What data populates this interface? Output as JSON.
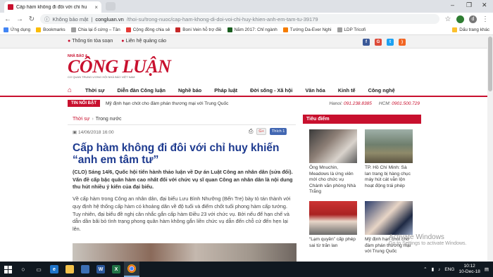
{
  "browser": {
    "tab_title": "Cấp hàm không đi đôi với chỉ hu",
    "security": "Không bảo mật",
    "url_host": "congluan.vn",
    "url_path": "/thoi-su/trong-nuoc/cap-ham-khong-di-doi-voi-chi-huy-khien-anh-em-tam-tu-39179",
    "avatar_letter": "d",
    "bookmarks": [
      "Ứng dụng",
      "Bookmarks",
      "Chia lại ổ cứng – Tân",
      "Cộng đồng chia sẻ",
      "Boni Vein hỗ trợ điề",
      "Năm 2017: Chỉ ngành",
      "Tướng Da-Ever Nghi",
      "LDP Tricofi"
    ],
    "bookmarks_right": "Dấu trang khác"
  },
  "topstrip": {
    "link1": "Thông tin tòa soạn",
    "link2": "Liên hệ quảng cáo"
  },
  "logo": {
    "small": "NHÀ BÁO &",
    "big": "CÔNG LUẬN",
    "tag": "CƠ QUAN TRUNG ƯƠNG HỘI NHÀ BÁO VIỆT NAM"
  },
  "nav": {
    "items": [
      "Thời sự",
      "Diễn đàn Công luận",
      "Nghề báo",
      "Pháp luật",
      "Đời sống - Xã hội",
      "Văn hóa",
      "Kinh tế",
      "Công nghệ"
    ]
  },
  "hotbar": {
    "badge": "TIN NỔI BẬT",
    "news": "Mỹ định hạn chót cho đàm phán thương mại với Trung Quốc",
    "hanoi_label": "Hanoi:",
    "hanoi_phone": "091.238.8385",
    "hcm_label": "HCM:",
    "hcm_phone": "0901.500.729"
  },
  "article": {
    "cat1": "Thời sự",
    "cat2": "Trong nước",
    "date": "14/06/2018 16:00",
    "gplus": "G+",
    "like": "Thích 1",
    "title": "Cấp hàm không đi đôi với chỉ huy khiến “anh em tâm tư”",
    "lead": "(CLO) Sáng 14/6, Quốc hội tiến hành thảo luận về Dự án Luật Công an nhân dân (sửa đổi). Vấn đề cấp bậc quân hàm cao nhất đối với chức vụ sĩ quan Công an nhân dân là nội dung thu hút nhiều ý kiến của đại biểu.",
    "body": "Về cấp hàm trong Công an nhân dân, đại biểu Lưu Bình Nhưỡng (Bến Tre) bày tỏ tán thành với quy định hệ thống cấp hàm có khoảng dãn về độ tuổi và điểm chốt tuổi phong hàm cấp tướng. Tuy nhiên, đại biểu đề nghị cân nhắc gắn cấp hàm Điều 23 với chức vụ. Bởi nếu để hạn chế và dẫn dần bãi bỏ tình trạng phong quân hàm không gắn liền chức vụ dẫn đến chỗ cứ đến hẹn lại lên."
  },
  "sidebar": {
    "heading": "Tiêu điểm",
    "cards": [
      {
        "caption": "Ông Mnuchin, Meadows là ứng viên mới cho chức vụ Chánh văn phòng Nhà Trắng"
      },
      {
        "caption": "TP. Hồ Chí Minh: Sà lan trang bị hàng chục máy hút cát vẫn lộn hoạt động trái phép"
      },
      {
        "caption": "“Lạm quyền” cấp phép sai từ trăn lan"
      },
      {
        "caption": "Mỹ định hạn chót cho đàm phán thương mại với Trung Quốc"
      }
    ]
  },
  "watermark": {
    "line1": "Activate Windows",
    "line2": "Go to Settings to activate Windows."
  },
  "taskbar": {
    "lang": "ENG",
    "time": "10:12",
    "date": "10-Dec-18"
  },
  "colors": {
    "brand_red": "#c8102e",
    "title_blue": "#1d3a8f"
  }
}
